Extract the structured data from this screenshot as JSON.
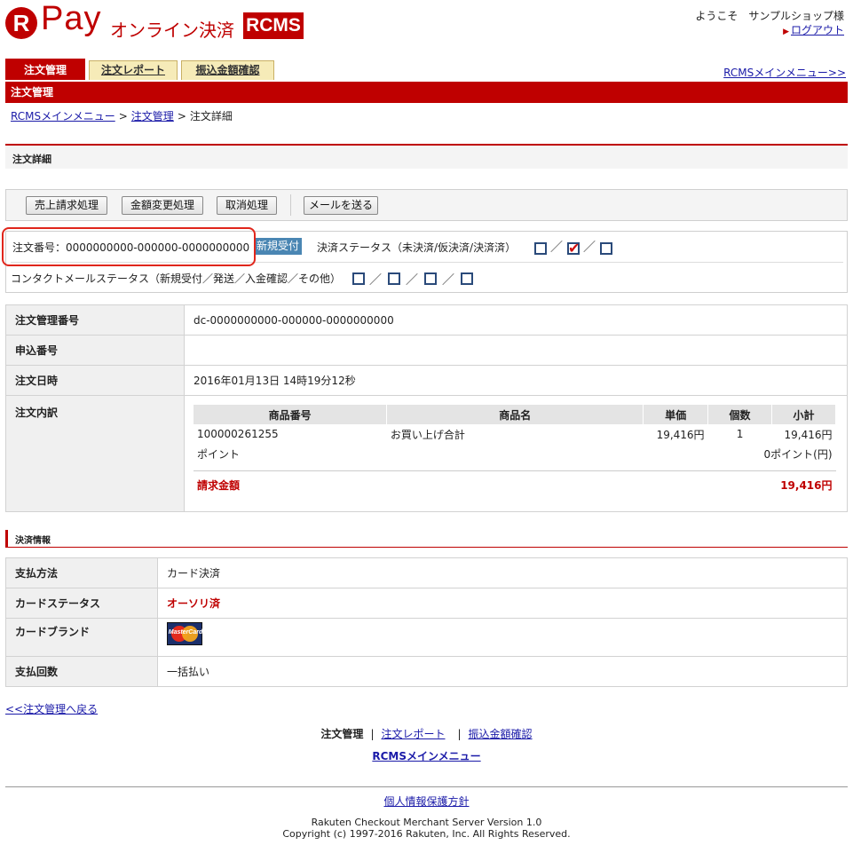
{
  "header": {
    "logo_letter": "R",
    "logo_pay": "Pay",
    "logo_online": "オンライン決済",
    "logo_rcms": "RCMS",
    "welcome": "ようこそ　サンプルショップ様",
    "logout": "ログアウト"
  },
  "tabs": [
    {
      "label": "注文管理",
      "active": true
    },
    {
      "label": "注文レポート",
      "active": false
    },
    {
      "label": "振込金額確認",
      "active": false
    }
  ],
  "rcms_menu_top": "RCMSメインメニュー>>",
  "page_title_bar": "注文管理",
  "breadcrumb": {
    "items": [
      "RCMSメインメニュー",
      "注文管理",
      "注文詳細"
    ],
    "separator": ">"
  },
  "section_order_detail": "注文詳細",
  "buttons": {
    "sales_request": "売上請求処理",
    "amount_change": "金額変更処理",
    "cancel": "取消処理",
    "send_mail": "メールを送る"
  },
  "status": {
    "order_number_label": "注文番号：0000000000-000000-0000000000",
    "badge": "新規受付",
    "payment_status_label": "決済ステータス（未決済/仮決済/決済済）",
    "payment_checks": [
      false,
      true,
      false
    ],
    "contact_label": "コンタクトメールステータス（新規受付／発送／入金確認／その他）",
    "contact_checks": [
      false,
      false,
      false,
      false
    ],
    "slash": "／"
  },
  "order_table": {
    "mgmt_no_label": "注文管理番号",
    "mgmt_no_value": "dc-0000000000-000000-0000000000",
    "app_no_label": "申込番号",
    "app_no_value": "",
    "date_label": "注文日時",
    "date_value": "2016年01月13日 14時19分12秒",
    "breakdown_label": "注文内訳",
    "items_headers": [
      "商品番号",
      "商品名",
      "単価",
      "個数",
      "小計"
    ],
    "item": {
      "number": "100000261255",
      "name": "お買い上げ合計",
      "price": "19,416円",
      "qty": "1",
      "subtotal": "19,416円"
    },
    "points_label": "ポイント",
    "points_value": "0ポイント(円)",
    "billing_label": "請求金額",
    "billing_value": "19,416円"
  },
  "section_payment": "決済情報",
  "payment_table": {
    "method_label": "支払方法",
    "method_value": "カード決済",
    "card_status_label": "カードステータス",
    "card_status_value": "オーソリ済",
    "brand_label": "カードブランド",
    "brand_text": "MasterCard",
    "installments_label": "支払回数",
    "installments_value": "一括払い"
  },
  "back_link": "<<注文管理へ戻る",
  "footer": {
    "nav_current": "注文管理",
    "nav_report": "注文レポート",
    "nav_transfer": "振込金額確認",
    "bar": "|",
    "main_menu": "RCMSメインメニュー",
    "privacy": "個人情報保護方針",
    "version": "Rakuten Checkout Merchant Server Version 1.0",
    "copyright": "Copyright (c) 1997-2016 Rakuten, Inc. All Rights Reserved."
  },
  "colors": {
    "brand_red": "#bf0000",
    "badge_blue": "#4a86b3",
    "highlight_red": "#e0261c"
  }
}
